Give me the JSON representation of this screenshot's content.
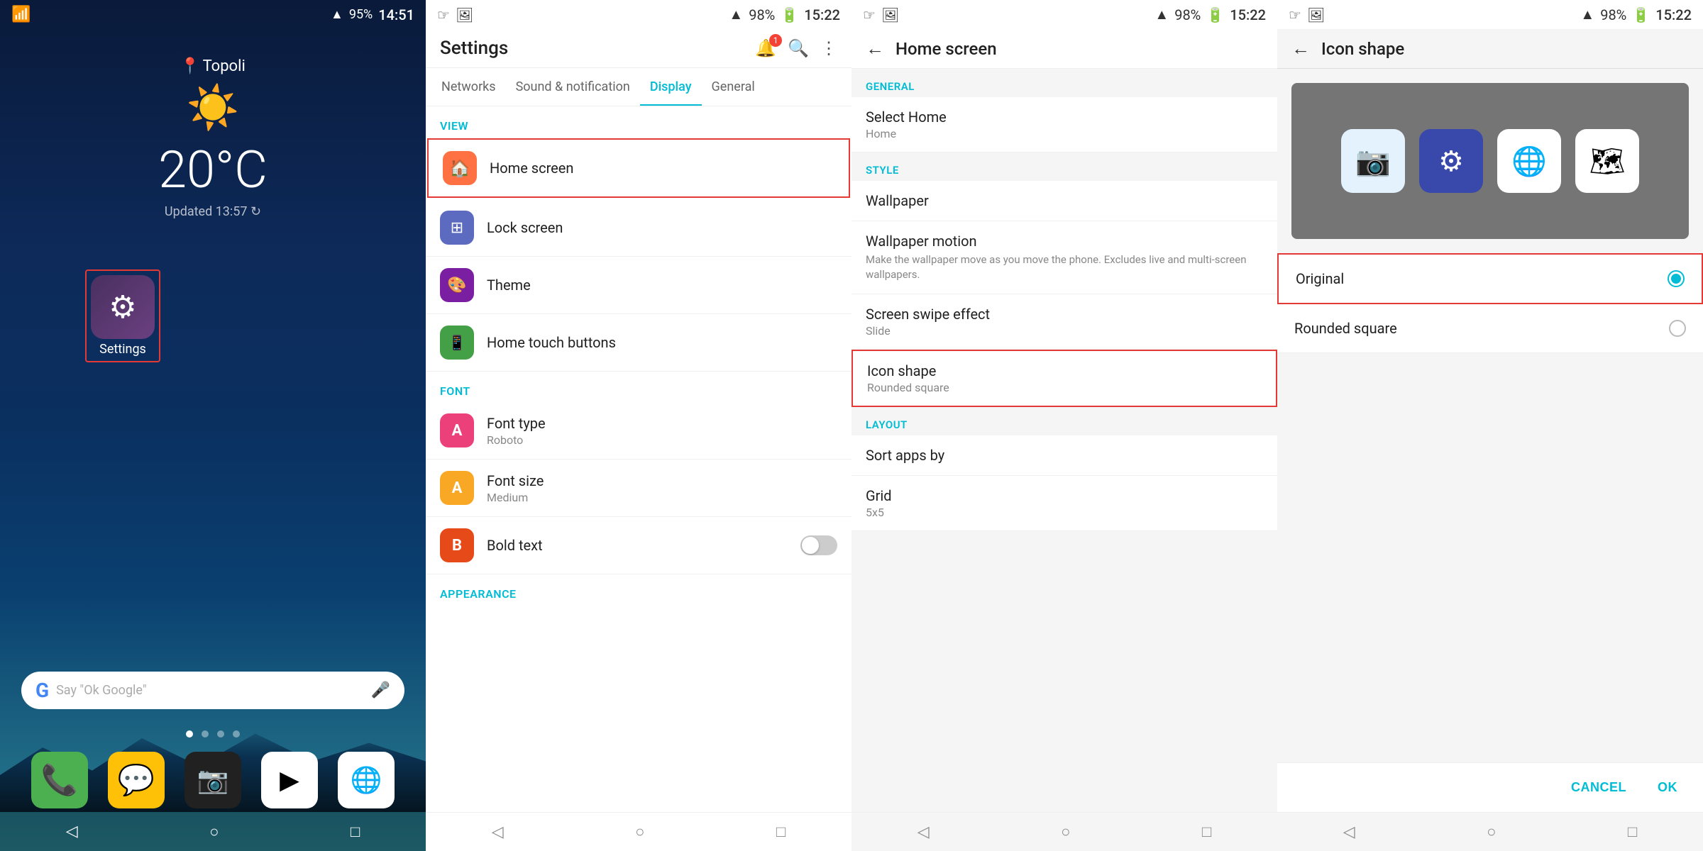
{
  "panel1": {
    "status": {
      "wifi": "📶",
      "signal": "▲",
      "battery": "95%",
      "time": "14:51"
    },
    "location": "Topoli",
    "temperature": "20°C",
    "updated": "Updated 13:57 ↻",
    "settings_label": "Settings",
    "search_placeholder": "Say \"Ok Google\"",
    "apps": [
      "📞",
      "💬",
      "📷",
      "▶",
      "🌐"
    ],
    "nav": [
      "◁",
      "○",
      "□"
    ]
  },
  "panel2": {
    "status": {
      "left": "☞ 🖼",
      "signal": "▲ 98%",
      "battery": "🔋",
      "time": "15:22"
    },
    "title": "Settings",
    "tabs": [
      {
        "label": "Networks",
        "active": false
      },
      {
        "label": "Sound & notification",
        "active": false
      },
      {
        "label": "Display",
        "active": true
      },
      {
        "label": "General",
        "active": false
      }
    ],
    "sections": [
      {
        "label": "VIEW",
        "items": [
          {
            "icon": "🏠",
            "icon_class": "orange",
            "title": "Home screen",
            "subtitle": "",
            "highlighted": true
          },
          {
            "icon": "⊞",
            "icon_class": "blue",
            "title": "Lock screen",
            "subtitle": ""
          },
          {
            "icon": "🎨",
            "icon_class": "purple",
            "title": "Theme",
            "subtitle": ""
          },
          {
            "icon": "📱",
            "icon_class": "green",
            "title": "Home touch buttons",
            "subtitle": ""
          }
        ]
      },
      {
        "label": "FONT",
        "items": [
          {
            "icon": "A",
            "icon_class": "pink",
            "title": "Font type",
            "subtitle": "Roboto"
          },
          {
            "icon": "A",
            "icon_class": "amber",
            "title": "Font size",
            "subtitle": "Medium"
          },
          {
            "icon": "B",
            "icon_class": "deep-orange",
            "title": "Bold text",
            "subtitle": "",
            "toggle": true
          }
        ]
      }
    ],
    "nav": [
      "◁",
      "○",
      "□"
    ]
  },
  "panel3": {
    "status": {
      "left": "☞ 🖼",
      "signal": "▲ 98%",
      "battery": "🔋",
      "time": "15:22"
    },
    "title": "Home screen",
    "sections": [
      {
        "label": "GENERAL",
        "items": [
          {
            "title": "Select Home",
            "subtitle": "Home"
          }
        ]
      },
      {
        "label": "STYLE",
        "items": [
          {
            "title": "Wallpaper",
            "subtitle": ""
          },
          {
            "title": "Wallpaper motion",
            "subtitle": "Make the wallpaper move as you move the phone. Excludes live and multi-screen wallpapers."
          },
          {
            "title": "Screen swipe effect",
            "subtitle": "Slide"
          },
          {
            "title": "Icon shape",
            "subtitle": "Rounded square",
            "highlighted": true
          }
        ]
      },
      {
        "label": "LAYOUT",
        "items": [
          {
            "title": "Sort apps by",
            "subtitle": ""
          },
          {
            "title": "Grid",
            "subtitle": "5x5"
          }
        ]
      }
    ],
    "nav": [
      "◁",
      "○",
      "□"
    ]
  },
  "panel4": {
    "status": {
      "left": "☞ 🖼",
      "signal": "▲ 98%",
      "battery": "🔋",
      "time": "15:22"
    },
    "title": "Icon shape",
    "options": [
      {
        "label": "Original",
        "selected": true
      },
      {
        "label": "Rounded square",
        "selected": false
      }
    ],
    "buttons": {
      "cancel": "CANCEL",
      "ok": "OK"
    },
    "nav": [
      "◁",
      "○",
      "□"
    ]
  }
}
